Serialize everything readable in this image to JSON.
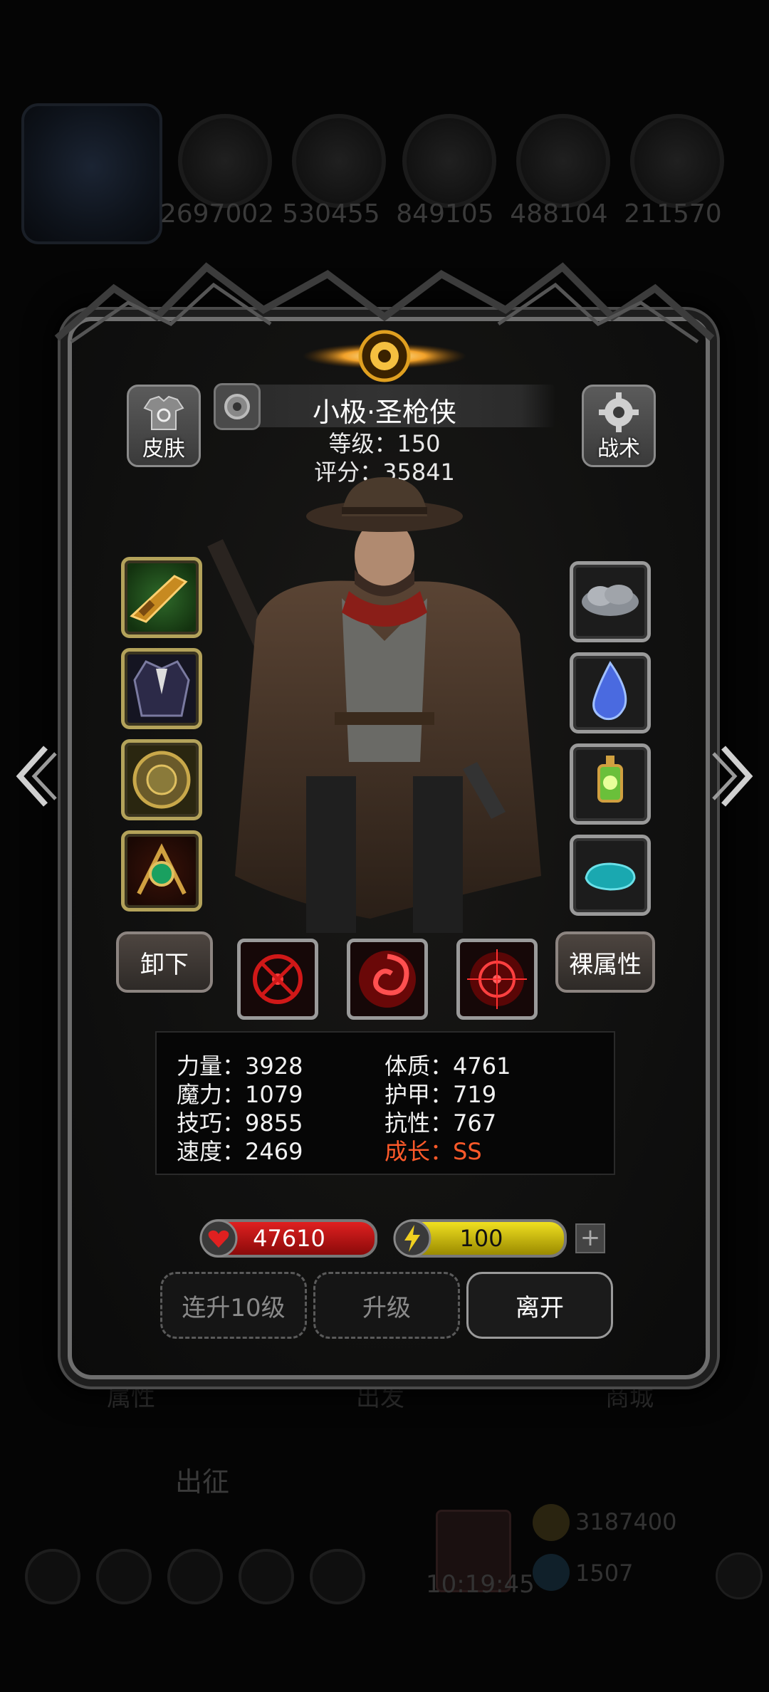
{
  "background": {
    "resources": [
      "2697002",
      "530455",
      "849105",
      "488104",
      "211570"
    ],
    "tabs": [
      "属性",
      "出发",
      "商城"
    ],
    "label_left": "出征",
    "clock": "10:19:45",
    "gold": "3187400",
    "gems": "1507"
  },
  "hero": {
    "name": "小极·圣枪侠",
    "level_text": "等级：150",
    "score_text": "评分：35841"
  },
  "buttons": {
    "skin": "皮肤",
    "tactics": "战术",
    "unequip": "卸下",
    "base_attr": "裸属性",
    "upgrade10": "连升10级",
    "upgrade": "升级",
    "leave": "离开",
    "plus": "+"
  },
  "stats": {
    "left": [
      "力量：3928",
      "魔力：1079",
      "技巧：9855",
      "速度：2469"
    ],
    "right": [
      "体质：4761",
      "护甲：719",
      "抗性：767",
      "成长：SS"
    ]
  },
  "bars": {
    "hp": "47610",
    "energy": "100"
  },
  "equipment_left": [
    "rifle-icon",
    "coat-icon",
    "shield-icon",
    "amulet-icon"
  ],
  "equipment_right": [
    "cloud-icon",
    "droplet-icon",
    "lantern-icon",
    "stone-icon"
  ],
  "colors": {
    "growth": "#ff5a2a",
    "hp": "#c4161c",
    "energy": "#d6c400"
  }
}
